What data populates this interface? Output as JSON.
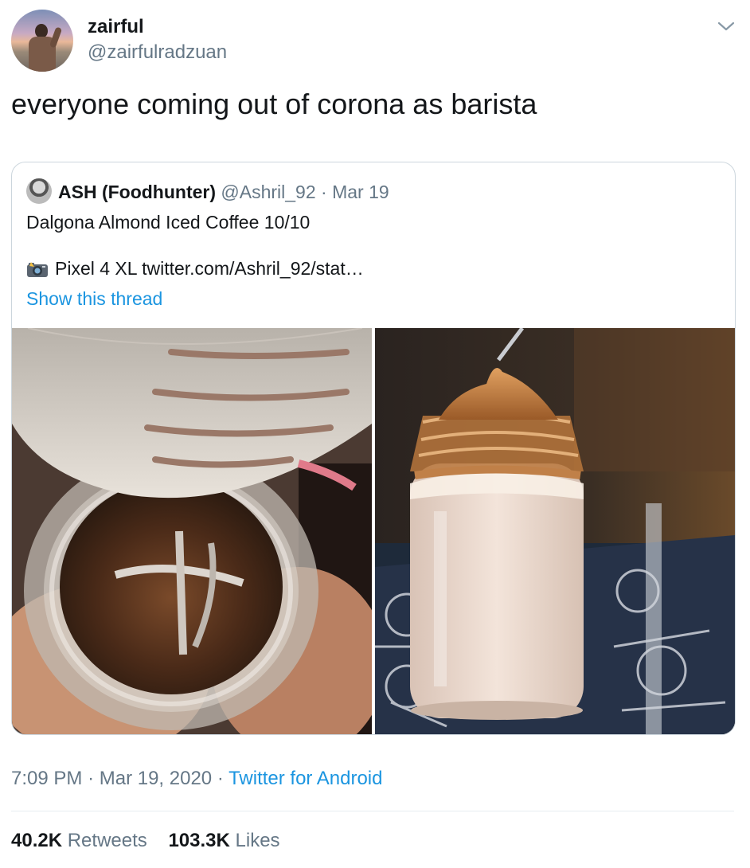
{
  "author": {
    "name": "zairful",
    "handle": "@zairfulradzuan"
  },
  "tweet": {
    "text": "everyone coming out of corona as barista",
    "time": "7:09 PM",
    "sep": "·",
    "date": "Mar 19, 2020",
    "source": "Twitter for Android"
  },
  "quoted": {
    "name": "ASH (Foodhunter)",
    "handle": "@Ashril_92",
    "sep": "·",
    "date": "Mar 19",
    "text": "Dalgona Almond Iced Coffee 10/10",
    "line2": "Pixel 4 XL twitter.com/Ashril_92/stat…",
    "show_thread": "Show this thread"
  },
  "stats": {
    "retweets_count": "40.2K",
    "retweets_label": "Retweets",
    "likes_count": "103.3K",
    "likes_label": "Likes"
  },
  "icons": {
    "menu": "chevron-down-icon",
    "camera": "camera-flash-icon"
  },
  "colors": {
    "link": "#1b95e0",
    "secondary_text": "#657786",
    "border": "#ccd6dd"
  }
}
